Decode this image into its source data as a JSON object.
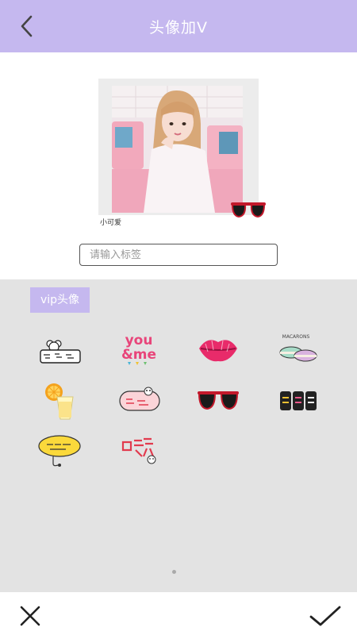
{
  "header": {
    "title": "头像加V",
    "back_icon": "back-arrow-icon"
  },
  "preview": {
    "caption": "小可爱",
    "overlay_sticker": "sunglasses"
  },
  "tag_input": {
    "placeholder": "请输入标签",
    "value": ""
  },
  "panel": {
    "tab_label": "vip头像",
    "stickers": [
      {
        "name": "bear-text-sticker",
        "text": ""
      },
      {
        "name": "you-and-me-sticker",
        "text": "you &me"
      },
      {
        "name": "lips-sticker",
        "text": ""
      },
      {
        "name": "macarons-sticker",
        "text": "MACARONS"
      },
      {
        "name": "lemonade-sticker",
        "text": ""
      },
      {
        "name": "pig-speech-sticker",
        "text": ""
      },
      {
        "name": "sunglasses-sticker",
        "text": ""
      },
      {
        "name": "bubble-text-sticker",
        "text": ""
      },
      {
        "name": "yellow-speech-bubble-sticker",
        "text": ""
      },
      {
        "name": "chi-huo-text-sticker",
        "text": ""
      }
    ],
    "page_indicator": {
      "current": 1
    }
  },
  "colors": {
    "accent": "#c5b8ef",
    "panel_bg": "#e3e3e3"
  },
  "footer": {
    "cancel_icon": "close-icon",
    "confirm_icon": "check-icon"
  }
}
